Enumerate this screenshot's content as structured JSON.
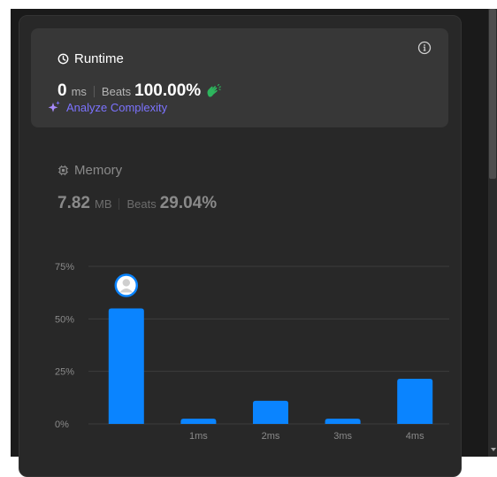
{
  "runtime": {
    "title": "Runtime",
    "value": "0",
    "unit": "ms",
    "beats_label": "Beats",
    "beats_value": "100.00%",
    "analyze_label": "Analyze Complexity",
    "icon": "clock-icon",
    "info_icon": "info-icon",
    "celebrate_icon": "clapping-hands-icon",
    "sparkle_icon": "sparkle-icon"
  },
  "memory": {
    "title": "Memory",
    "value": "7.82",
    "unit": "MB",
    "beats_label": "Beats",
    "beats_value": "29.04%",
    "icon": "chip-icon"
  },
  "colors": {
    "accent_blue": "#0a84ff",
    "analyze_purple": "#7c73ff",
    "celebrate_green": "#2db55d",
    "bg": "#282828",
    "card": "#373737"
  },
  "chart_data": {
    "type": "bar",
    "categories": [
      "",
      "1ms",
      "2ms",
      "3ms",
      "4ms"
    ],
    "values": [
      55,
      2.5,
      11,
      2.5,
      21.5
    ],
    "yticks": [
      "75%",
      "50%",
      "25%",
      "0%"
    ],
    "ylim": [
      0,
      75
    ],
    "highlight_index": 0,
    "highlight_marker": "avatar-icon",
    "grid": true
  }
}
